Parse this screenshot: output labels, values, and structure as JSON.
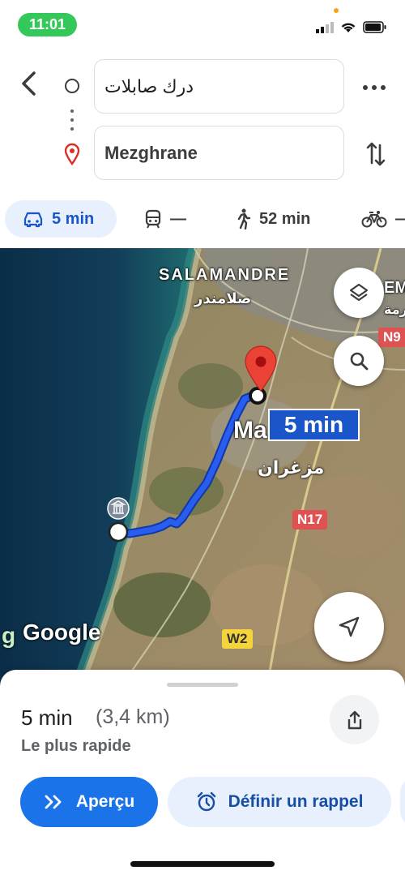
{
  "status_bar": {
    "time": "11:01"
  },
  "directions": {
    "origin": "درك صابلات",
    "destination": "Mezghrane"
  },
  "travel_modes": [
    {
      "mode": "car",
      "label": "5 min",
      "selected": true
    },
    {
      "mode": "transit",
      "label": "—"
    },
    {
      "mode": "walk",
      "label": "52 min"
    },
    {
      "mode": "bike",
      "label": "—"
    }
  ],
  "map": {
    "labels": {
      "salamandre": "SALAMANDRE",
      "salamandre_ar": "صلامندر",
      "mezghrane": "Ma",
      "mezghrane_ar": "مزغران",
      "edge_top": "EM",
      "edge_top_ar": "ـرمة"
    },
    "road_shields": {
      "n17": "N17",
      "n9": "N9",
      "w2": "W2"
    },
    "route_time_badge": "5 min",
    "logo": "Google",
    "colors": {
      "route": "#1a56c9",
      "route_outline": "#0b3aa8",
      "pin": "#ea4335",
      "sea": "#0c3a5c"
    }
  },
  "summary": {
    "duration": "5 min",
    "distance": "(3,4 km)",
    "description": "Le plus rapide"
  },
  "actions": {
    "overview": "Aperçu",
    "reminder": "Définir un rappel"
  },
  "icons": [
    "back-arrow-icon",
    "more-dots-icon",
    "swap-icon",
    "car-icon",
    "train-icon",
    "walk-icon",
    "bike-icon",
    "layers-icon",
    "search-icon",
    "navigate-arrow-icon",
    "share-icon",
    "double-chevron-icon",
    "alarm-clock-icon",
    "museum-icon",
    "location-pin-icon"
  ]
}
